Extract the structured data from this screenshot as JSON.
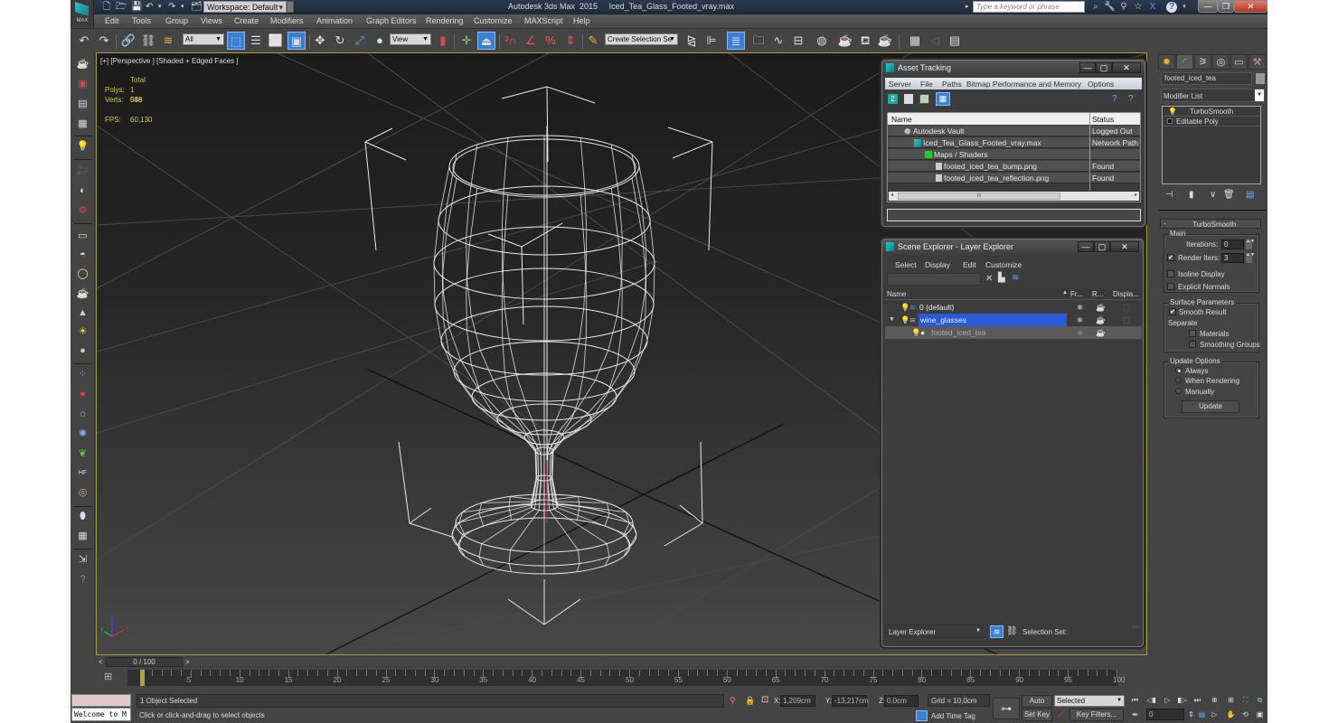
{
  "titlebar": {
    "app_title": "Autodesk 3ds Max  2015     Iced_Tea_Glass_Footed_vray.max",
    "workspace": "Workspace: Default",
    "logo_label": "MAX",
    "search_placeholder": "Type a keyword or phrase",
    "window_buttons": {
      "minimize": "—",
      "maximize": "❐",
      "close": "✕"
    }
  },
  "menu": [
    "Edit",
    "Tools",
    "Group",
    "Views",
    "Create",
    "Modifiers",
    "Animation",
    "Graph Editors",
    "Rendering",
    "Customize",
    "MAXScript",
    "Help"
  ],
  "toolbar": {
    "selection_filter": "All",
    "reference_coord": "View",
    "named_selection_placeholder": "Create Selection Se"
  },
  "viewport": {
    "label": "[+] [Perspective ] [Shaded + Edged Faces ]",
    "stats_header": "Total",
    "polys_label": "Polys:",
    "polys_value": "1 088",
    "verts_label": "Verts:",
    "verts_value": "546",
    "fps_label": "FPS:",
    "fps_value": "60,130",
    "axis": {
      "x": "x",
      "y": "y",
      "z": "z"
    }
  },
  "asset_tracking": {
    "title": "Asset Tracking",
    "menu": [
      "Server",
      "File",
      "Paths",
      "Bitmap Performance and Memory",
      "Options"
    ],
    "columns": [
      "Name",
      "Status"
    ],
    "rows": [
      {
        "name": "Autodesk Vault",
        "status": "Logged Out ..."
      },
      {
        "name": "Iced_Tea_Glass_Footed_vray.max",
        "status": "Network Path"
      },
      {
        "name": "Maps / Shaders",
        "status": ""
      },
      {
        "name": "footed_iced_tea_bump.png",
        "status": "Found"
      },
      {
        "name": "footed_iced_tea_reflection.png",
        "status": "Found"
      }
    ],
    "scroll_grip": "III"
  },
  "scene_explorer": {
    "title": "Scene Explorer - Layer Explorer",
    "menu": [
      "Select",
      "Display",
      "Edit",
      "Customize"
    ],
    "columns": [
      "Name",
      "Fr...",
      "R...",
      "Displa..."
    ],
    "rows": [
      {
        "name": "0 (default)",
        "selected": false
      },
      {
        "name": "wine_glasses",
        "selected": true
      },
      {
        "name": "footed_iced_tea",
        "selected": false
      }
    ],
    "footer_dropdown": "Layer Explorer",
    "selection_set_label": "Selection Set:",
    "more": ">>"
  },
  "command_panel": {
    "object_name": "footed_iced_tea",
    "modifier_list": "Modifier List",
    "stack": [
      "TurboSmooth",
      "Editable Poly"
    ],
    "rollout_title": "TurboSmooth",
    "main_group": "Main",
    "iterations_label": "Iterations:",
    "iterations_value": "0",
    "render_iters_label": "Render Iters:",
    "render_iters_value": "3",
    "render_iters_checked": true,
    "isoline_display": "Isoline Display",
    "isoline_checked": false,
    "explicit_normals": "Explicit Normals",
    "explicit_checked": false,
    "surface_group": "Surface Parameters",
    "smooth_result": "Smooth Result",
    "smooth_checked": true,
    "separate_label": "Separate",
    "materials": "Materials",
    "smoothing_groups": "Smoothing Groups",
    "update_group": "Update Options",
    "radio_always": "Always",
    "radio_when_rendering": "When Rendering",
    "radio_manually": "Manually",
    "update_selected": "Always",
    "update_button": "Update"
  },
  "timeline": {
    "slider_text": "0 / 100",
    "prev": "<",
    "next": ">",
    "current_frame": 0,
    "range": [
      0,
      100
    ],
    "labels": [
      "5",
      "10",
      "15",
      "20",
      "25",
      "30",
      "35",
      "40",
      "45",
      "50",
      "55",
      "60",
      "65",
      "70",
      "75",
      "80",
      "85",
      "90",
      "95",
      "100"
    ]
  },
  "status": {
    "listener": "Welcome to M",
    "selection": "1 Object Selected",
    "prompt": "Click or click-and-drag to select objects",
    "x_label": "X:",
    "x_value": "1,209cm",
    "y_label": "Y:",
    "y_value": "-13,217cm",
    "z_label": "Z:",
    "z_value": "0,0cm",
    "grid": "Grid = 10,0cm",
    "add_time_tag": "Add Time Tag",
    "auto_key": "Auto Key",
    "set_key": "Set Key",
    "key_mode": "Selected",
    "key_filters": "Key Filters...",
    "frame_value": "0"
  },
  "colors": {
    "viewport_border": "#b09a3e",
    "stats_text": "#d8c94a",
    "selection_blue": "#2a5bd7",
    "active_button": "#3b7fd4"
  }
}
